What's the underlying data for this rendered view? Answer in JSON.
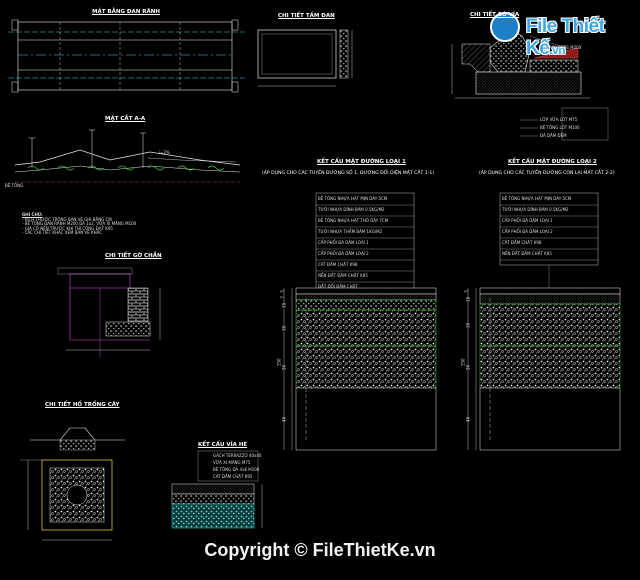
{
  "logo": {
    "text": "File Thiết Kế",
    "suffix": ".vn"
  },
  "copyright": "Copyright © FileThietKe.vn",
  "titles": {
    "plan": "MẶT BẰNG ĐAN RÃNH",
    "cover_detail": "CHI TIẾT TẤM ĐAN",
    "curb_detail": "CHI TIẾT BÓ VỈA",
    "section": "MẶT CẮT A-A",
    "pavement_1": "KẾT CẤU MẶT ĐƯỜNG LOẠI 1",
    "pavement_1_sub": "(ÁP DỤNG CHO CÁC TUYẾN ĐƯỜNG SỐ 1, ĐƯỜNG ĐỐI DIỆN MẶT CẮT 1-1)",
    "pavement_2": "KẾT CẤU MẶT ĐƯỜNG LOẠI 2",
    "pavement_2_sub": "(ÁP DỤNG CHO CÁC TUYẾN ĐƯỜNG CÒN LẠI MẶT CẮT 2-2)",
    "wall_detail": "CHI TIẾT GỜ CHẮN",
    "tree_pit": "CHI TIẾT HỐ TRỒNG CÂY",
    "sidewalk": "KẾT CẤU VỈA HÈ"
  },
  "notes": {
    "heading": "GHI CHÚ:",
    "lines": [
      "- KÍCH THƯỚC TRONG BẢN VẼ GHI BẰNG CM",
      "- BÊ TÔNG ĐAN RÃNH M200 ĐÁ 1x2, VỮA XI MĂNG M100",
      "- GIA CỐ NỀN TRƯỚC KHI THI CÔNG ĐẠT K95",
      "- CÁC CHI TIẾT KHÁC XEM BẢN VẼ KHÁC"
    ]
  },
  "pavement_layers": [
    "BÊ TÔNG NHỰA HẠT MỊN DÀY 5CM",
    "TƯỚI NHỰA DÍNH BÁM 0.5KG/M2",
    "BÊ TÔNG NHỰA HẠT THÔ DÀY 7CM",
    "TƯỚI NHỰA THẤM BÁM 1KG/M2",
    "CẤP PHỐI ĐÁ DĂM LOẠI 1",
    "CẤP PHỐI ĐÁ DĂM LOẠI 2",
    "CÁT ĐẦM CHẶT K98",
    "NỀN ĐẤT ĐẦM CHẶT K95",
    "ĐẤT ĐỒI ĐẦM CHẶT"
  ],
  "pavement_layers_2": [
    "BÊ TÔNG NHỰA HẠT MỊN DÀY 5CM",
    "TƯỚI NHỰA DÍNH BÁM 0.5KG/M2",
    "CẤP PHỐI ĐÁ DĂM LOẠI 1",
    "CẤP PHỐI ĐÁ DĂM LOẠI 2",
    "CÁT ĐẦM CHẶT K98",
    "NỀN ĐẤT ĐẦM CHẶT K95"
  ],
  "curb_labels": [
    "BÓ VỈA BTĐS M200",
    "LỚP VỮA LÓT M75",
    "BÊ TÔNG LÓT M100",
    "ĐÁ DĂM ĐỆM"
  ],
  "sidewalk_labels": [
    "GẠCH TERRAZZO 40x40",
    "VỮA XI MĂNG M75",
    "BÊ TÔNG ĐÁ 4x6 M100",
    "CÁT ĐẦM CHẶT K95"
  ],
  "dims": {
    "left_stack": [
      "5",
      "7",
      "15",
      "30",
      "50",
      "40"
    ],
    "right_stack": [
      "5",
      "15",
      "30",
      "50",
      "40"
    ],
    "total": "150"
  },
  "section_labels": {
    "slope": "i=2%",
    "axis": "TIM ĐƯỜNG",
    "ground": "BÊ TÔNG"
  }
}
